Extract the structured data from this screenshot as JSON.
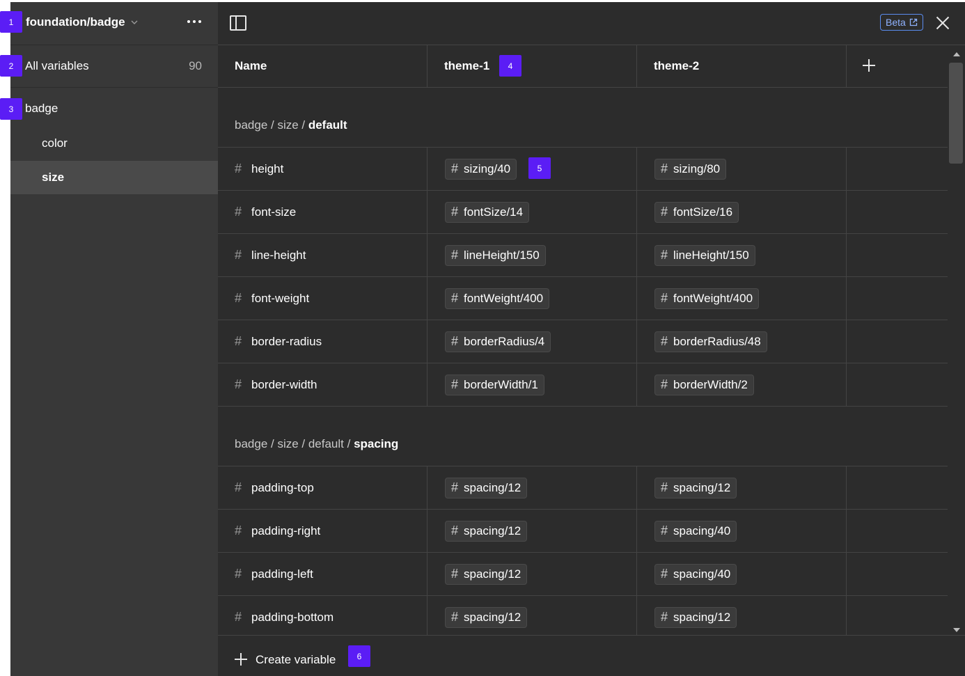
{
  "sidebar": {
    "title": "foundation/badge",
    "all_label": "All variables",
    "all_count": "90",
    "group": "badge",
    "items": [
      {
        "label": "color",
        "selected": false
      },
      {
        "label": "size",
        "selected": true
      }
    ]
  },
  "topbar": {
    "beta_label": "Beta"
  },
  "table": {
    "headers": [
      "Name",
      "theme-1",
      "theme-2"
    ],
    "groups": [
      {
        "path_prefix": "badge / size / ",
        "path_last": "default",
        "rows": [
          {
            "name": "height",
            "theme1": "sizing/40",
            "theme2": "sizing/80"
          },
          {
            "name": "font-size",
            "theme1": "fontSize/14",
            "theme2": "fontSize/16"
          },
          {
            "name": "line-height",
            "theme1": "lineHeight/150",
            "theme2": "lineHeight/150"
          },
          {
            "name": "font-weight",
            "theme1": "fontWeight/400",
            "theme2": "fontWeight/400"
          },
          {
            "name": "border-radius",
            "theme1": "borderRadius/4",
            "theme2": "borderRadius/48"
          },
          {
            "name": "border-width",
            "theme1": "borderWidth/1",
            "theme2": "borderWidth/2"
          }
        ]
      },
      {
        "path_prefix": "badge / size / default / ",
        "path_last": "spacing",
        "rows": [
          {
            "name": "padding-top",
            "theme1": "spacing/12",
            "theme2": "spacing/12"
          },
          {
            "name": "padding-right",
            "theme1": "spacing/12",
            "theme2": "spacing/40"
          },
          {
            "name": "padding-left",
            "theme1": "spacing/12",
            "theme2": "spacing/40"
          },
          {
            "name": "padding-bottom",
            "theme1": "spacing/12",
            "theme2": "spacing/12"
          }
        ]
      }
    ]
  },
  "footer": {
    "create_label": "Create variable"
  },
  "markers": [
    "1",
    "2",
    "3",
    "4",
    "5",
    "6"
  ],
  "colors": {
    "accent": "#5b1df5",
    "background": "#2c2c2c",
    "sidebar": "#383838"
  },
  "icons": {
    "row": "hash-icon",
    "add": "plus-icon",
    "close": "close-icon"
  }
}
